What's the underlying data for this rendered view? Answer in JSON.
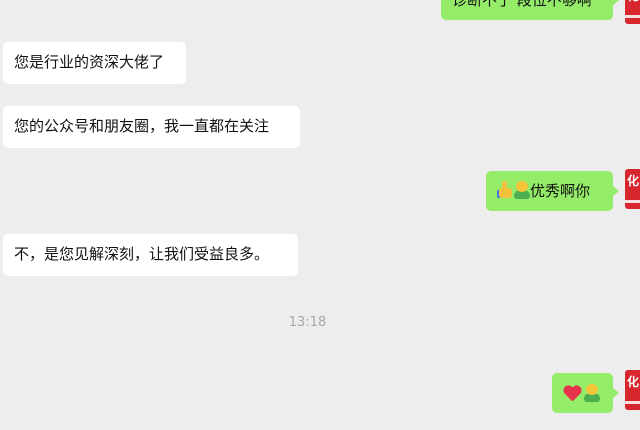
{
  "messages": [
    {
      "id": "m0",
      "side": "right",
      "text": "诊断不了 段位不够啊",
      "partial": true
    },
    {
      "id": "m1",
      "side": "left",
      "text": "您是行业的资深大佬了"
    },
    {
      "id": "m2",
      "side": "left",
      "text": "您的公众号和朋友圈，我一直都在关注"
    },
    {
      "id": "m3",
      "side": "right",
      "text": "优秀啊你",
      "emojis": [
        "thumbs-up-icon",
        "hug-emoji-icon"
      ]
    },
    {
      "id": "m4",
      "side": "left",
      "text": "不，是您见解深刻，让我们受益良多。"
    },
    {
      "id": "m5",
      "side": "right",
      "text": "",
      "emojis": [
        "heart-icon",
        "hug-emoji-icon"
      ]
    }
  ],
  "timestamp": "13:18",
  "colors": {
    "background": "#ededed",
    "sent_bubble": "#95ec69",
    "received_bubble": "#ffffff",
    "avatar": "#d7262d"
  }
}
